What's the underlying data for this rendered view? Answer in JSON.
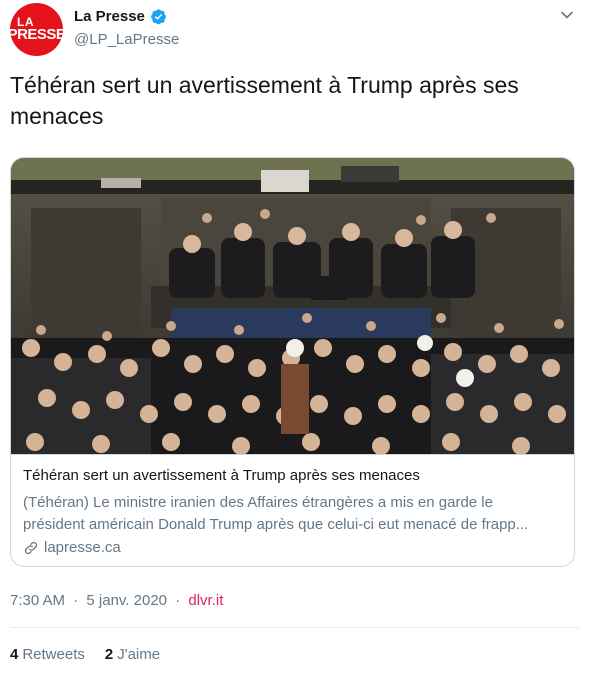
{
  "account": {
    "logo_text_1": "LA",
    "logo_text_2": "PRESSE",
    "display_name": "La Presse",
    "handle": "@LP_LaPresse",
    "brand_color": "#e3121b",
    "verified_color": "#1da1f2"
  },
  "tweet": {
    "text": "Téhéran sert un avertissement à Trump après ses menaces"
  },
  "card": {
    "image_alt": "Photo: members of Iran's parliament raising fists in the chamber",
    "title": "Téhéran sert un avertissement à Trump après ses menaces",
    "description_line1": "(Téhéran) Le ministre iranien des Affaires étrangères a mis en garde le",
    "description_line2": "président américain Donald Trump après que celui-ci eut menacé de frapp...",
    "domain": "lapresse.ca"
  },
  "meta": {
    "time": "7:30 AM",
    "separator": "·",
    "date": "5 janv. 2020",
    "source": "dlvr.it"
  },
  "stats": {
    "retweets_count": "4",
    "retweets_label": "Retweets",
    "likes_count": "2",
    "likes_label": "J'aime"
  }
}
